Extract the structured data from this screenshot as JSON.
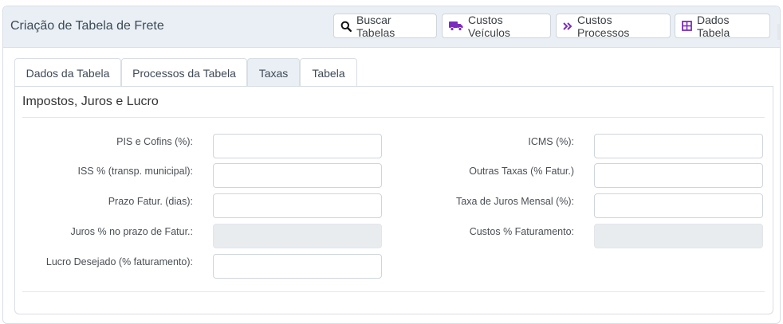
{
  "header": {
    "title": "Criação de Tabela de Frete",
    "buttons": {
      "buscar": "Buscar Tabelas",
      "custos_veiculos": "Custos Veículos",
      "custos_processos": "Custos Processos",
      "dados_tabela": "Dados Tabela"
    },
    "colors": {
      "accent": "#7b2cbf",
      "header_bg": "#e9eff5"
    }
  },
  "tabs": [
    {
      "label": "Dados da Tabela",
      "active": false
    },
    {
      "label": "Processos da Tabela",
      "active": false
    },
    {
      "label": "Taxas",
      "active": true
    },
    {
      "label": "Tabela",
      "active": false
    }
  ],
  "section": {
    "title": "Impostos, Juros e Lucro"
  },
  "form": {
    "left": [
      {
        "label": "PIS e Cofins (%):",
        "value": "",
        "readonly": false
      },
      {
        "label": "ISS % (transp. municipal):",
        "value": "",
        "readonly": false
      },
      {
        "label": "Prazo Fatur. (dias):",
        "value": "",
        "readonly": false
      },
      {
        "label": "Juros % no prazo de Fatur.:",
        "value": "",
        "readonly": true
      },
      {
        "label": "Lucro Desejado (% faturamento):",
        "value": "",
        "readonly": false
      }
    ],
    "right": [
      {
        "label": "ICMS (%):",
        "value": "",
        "readonly": false
      },
      {
        "label": "Outras Taxas (% Fatur.)",
        "value": "",
        "readonly": false
      },
      {
        "label": "Taxa de Juros Mensal (%):",
        "value": "",
        "readonly": false
      },
      {
        "label": "Custos % Faturamento:",
        "value": "",
        "readonly": true
      }
    ]
  }
}
